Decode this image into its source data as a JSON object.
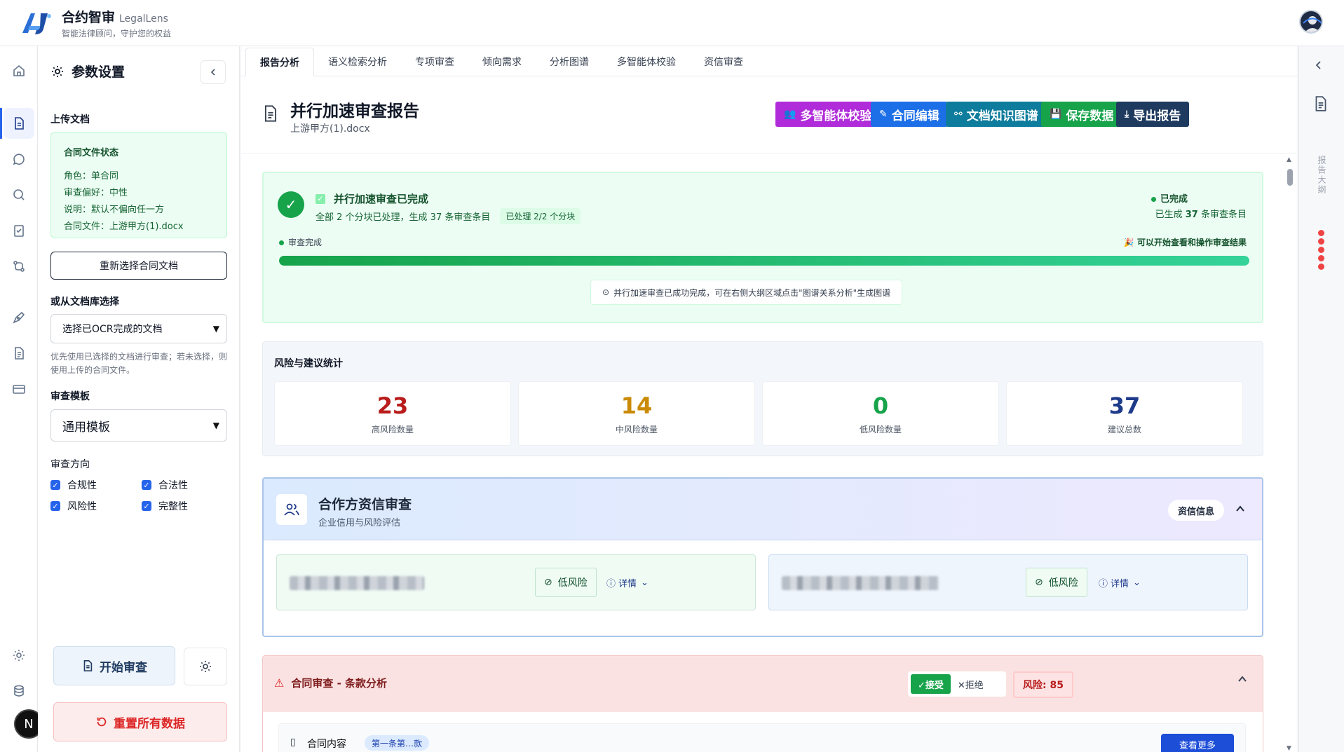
{
  "brand": {
    "title": "合约智审",
    "english": "LegalLens",
    "subtitle": "智能法律顾问，守护您的权益"
  },
  "settings": {
    "title": "参数设置",
    "upload_label": "上传文档",
    "status": {
      "title": "合同文件状态",
      "role": "角色：单合同",
      "preference": "审查偏好：中性",
      "note": "说明：默认不偏向任一方",
      "file": "合同文件：上游甲方(1).docx"
    },
    "reselect_label": "重新选择合同文档",
    "library_label": "或从文档库选择",
    "library_select": "选择已OCR完成的文档",
    "hint": "优先使用已选择的文档进行审查；若未选择，则使用上传的合同文件。",
    "template_label": "审查模板",
    "template_select": "通用模板",
    "direction_label": "审查方向",
    "directions": [
      "合规性",
      "合法性",
      "风险性",
      "完整性"
    ],
    "start_label": "开始审查",
    "reset_label": "重置所有数据"
  },
  "tabs": [
    "报告分析",
    "语义检索分析",
    "专项审查",
    "倾向需求",
    "分析图谱",
    "多智能体校验",
    "资信审查"
  ],
  "report": {
    "title": "并行加速审查报告",
    "file": "上游甲方(1).docx",
    "actions": {
      "multi_agent": "多智能体校验",
      "edit": "合同编辑",
      "graph": "文档知识图谱",
      "save": "保存数据",
      "export": "导出报告"
    },
    "colors": {
      "multi_agent": "#b02bd9",
      "edit": "#1d6fe8",
      "graph": "#0e7c9c",
      "save": "#16a34a",
      "export": "#1e3a5f"
    }
  },
  "completion": {
    "title": "并行加速审查已完成",
    "summary": "全部 2 个分块已处理，生成 37 条审查条目",
    "chip": "已处理 2/2 个分块",
    "status": "已完成",
    "generated_prefix": "已生成 ",
    "generated_count": "37",
    "generated_suffix": " 条审查条目",
    "progress_label": "审查完成",
    "progress_right": "可以开始查看和操作审查结果",
    "progress": 1.0,
    "note": "并行加速审查已成功完成，可在右侧大纲区域点击\"图谱关系分析\"生成图谱"
  },
  "stats": {
    "title": "风险与建议统计",
    "items": [
      {
        "value": "23",
        "label": "高风险数量",
        "color": "#b91c1c"
      },
      {
        "value": "14",
        "label": "中风险数量",
        "color": "#ca8a04"
      },
      {
        "value": "0",
        "label": "低风险数量",
        "color": "#16a34a"
      },
      {
        "value": "37",
        "label": "建议总数",
        "color": "#1e3a8a"
      }
    ]
  },
  "credit": {
    "title": "合作方资信审查",
    "subtitle": "企业信用与风险评估",
    "info_pill": "资信信息",
    "companies": [
      {
        "risk": "低风险",
        "detail": "详情"
      },
      {
        "risk": "低风险",
        "detail": "详情"
      }
    ]
  },
  "contract": {
    "title": "合同审查 - 条款分析",
    "accept": "✓接受",
    "reject": "✕拒绝",
    "risk": "风险: 85",
    "sub_label": "合同内容",
    "sub_tag": "第一条第…款",
    "sub_button": "查看更多"
  },
  "right_panel": {
    "vertical_label": "报告大纲"
  },
  "user_badge": "N"
}
